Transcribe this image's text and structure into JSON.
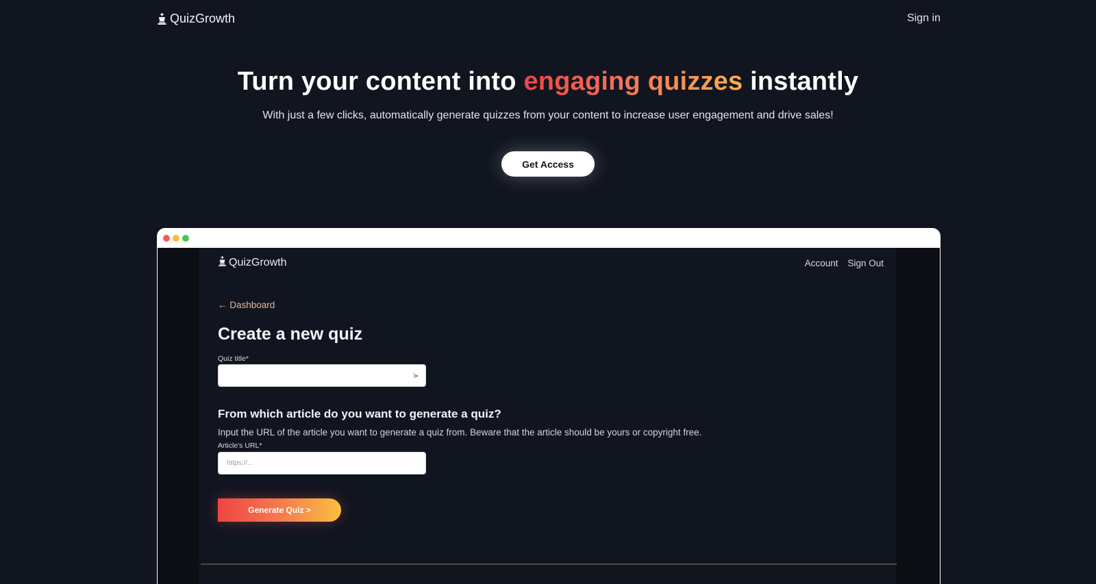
{
  "nav": {
    "brand": "QuizGrowth",
    "brand_icon": "chess-king-icon",
    "sign_in": "Sign in"
  },
  "hero": {
    "title_part1": "Turn your content into ",
    "title_highlight": "engaging quizzes",
    "title_part2": " instantly",
    "subtitle": "With just a few clicks, automatically generate quizzes from your content to increase user engagement and drive sales!",
    "cta": "Get Access"
  },
  "mockup": {
    "brand": "QuizGrowth",
    "nav_links": [
      "Account",
      "Sign Out"
    ],
    "back_link": "← Dashboard",
    "page_title": "Create a new quiz",
    "quiz_title_label": "Quiz title*",
    "quiz_title_value": "",
    "section_title": "From which article do you want to generate a quiz?",
    "section_desc": "Input the URL of the article you want to generate a quiz from. Beware that the article should be yours or copyright free.",
    "url_label": "Article's URL*",
    "url_placeholder": "https://...",
    "generate_button": "Generate Quiz >"
  },
  "colors": {
    "background": "#111520",
    "accent_gradient_start": "#ef4444",
    "accent_gradient_end": "#f9b04a",
    "back_link": "#e6b98a"
  }
}
